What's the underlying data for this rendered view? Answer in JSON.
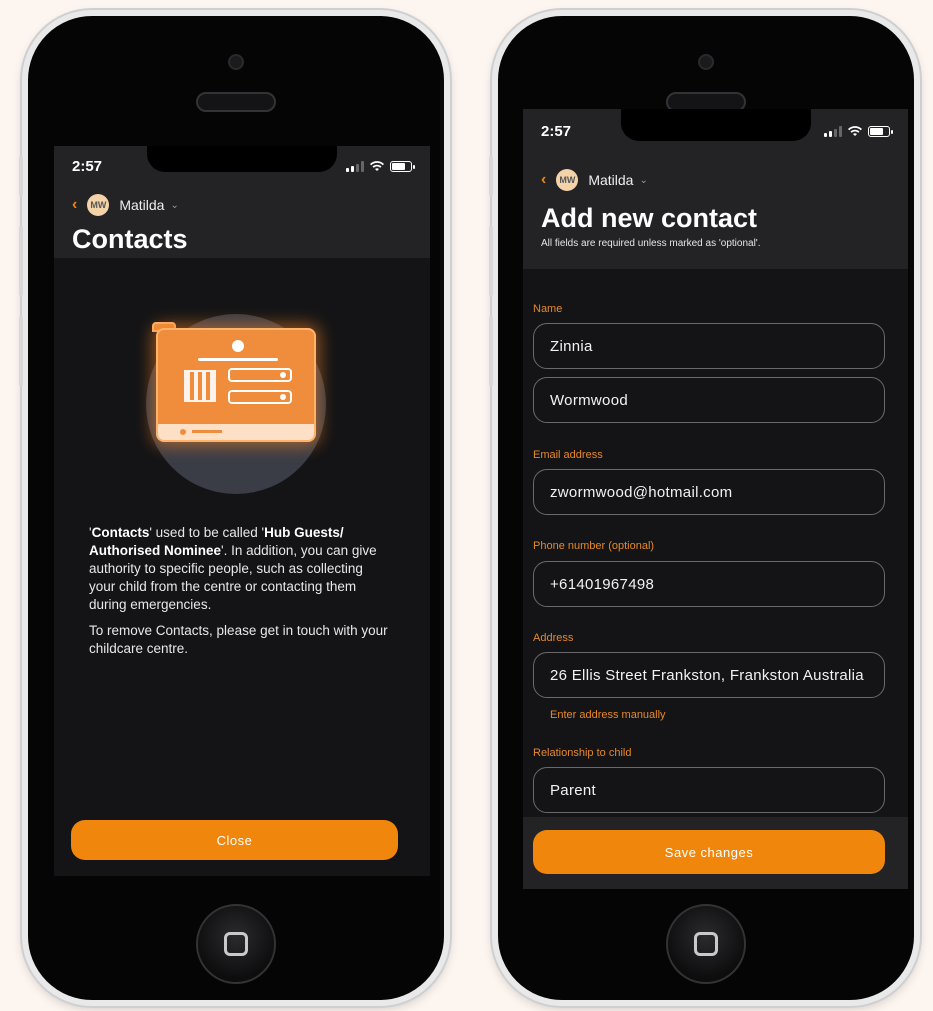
{
  "colors": {
    "accent": "#f0860b",
    "label": "#e5882a",
    "background": "#fdf5f0",
    "screen": "#141416",
    "header": "#232326"
  },
  "left_phone": {
    "status_time": "2:57",
    "user": {
      "initials": "MW",
      "name": "Matilda",
      "caret": "⌄"
    },
    "title": "Contacts",
    "paragraph1": {
      "part1": "'",
      "bold1": "Contacts",
      "part2": "' used to be called '",
      "bold2": "Hub Guests/ Authorised Nominee",
      "part3": "'. In addition, you can give authority to specific people, such as collecting your child from the centre or contacting them during emergencies."
    },
    "paragraph2": "To remove Contacts, please get in touch with your childcare centre.",
    "close_label": "Close"
  },
  "right_phone": {
    "status_time": "2:57",
    "user": {
      "initials": "MW",
      "name": "Matilda",
      "caret": "⌄"
    },
    "title": "Add new contact",
    "subtitle": "All fields are required unless marked as 'optional'.",
    "fields": {
      "name_label": "Name",
      "first_name": "Zinnia",
      "last_name": "Wormwood",
      "email_label": "Email address",
      "email": "zwormwood@hotmail.com",
      "phone_label": "Phone number (optional)",
      "phone": "+61401967498",
      "address_label": "Address",
      "address": "26 Ellis Street Frankston, Frankston Australia",
      "manual_address_link": "Enter address manually",
      "relationship_label": "Relationship to child",
      "relationship": "Parent"
    },
    "save_label": "Save changes"
  },
  "icons": [
    "back-chevron-icon",
    "signal-icon",
    "wifi-icon",
    "battery-icon",
    "home-button-icon"
  ]
}
